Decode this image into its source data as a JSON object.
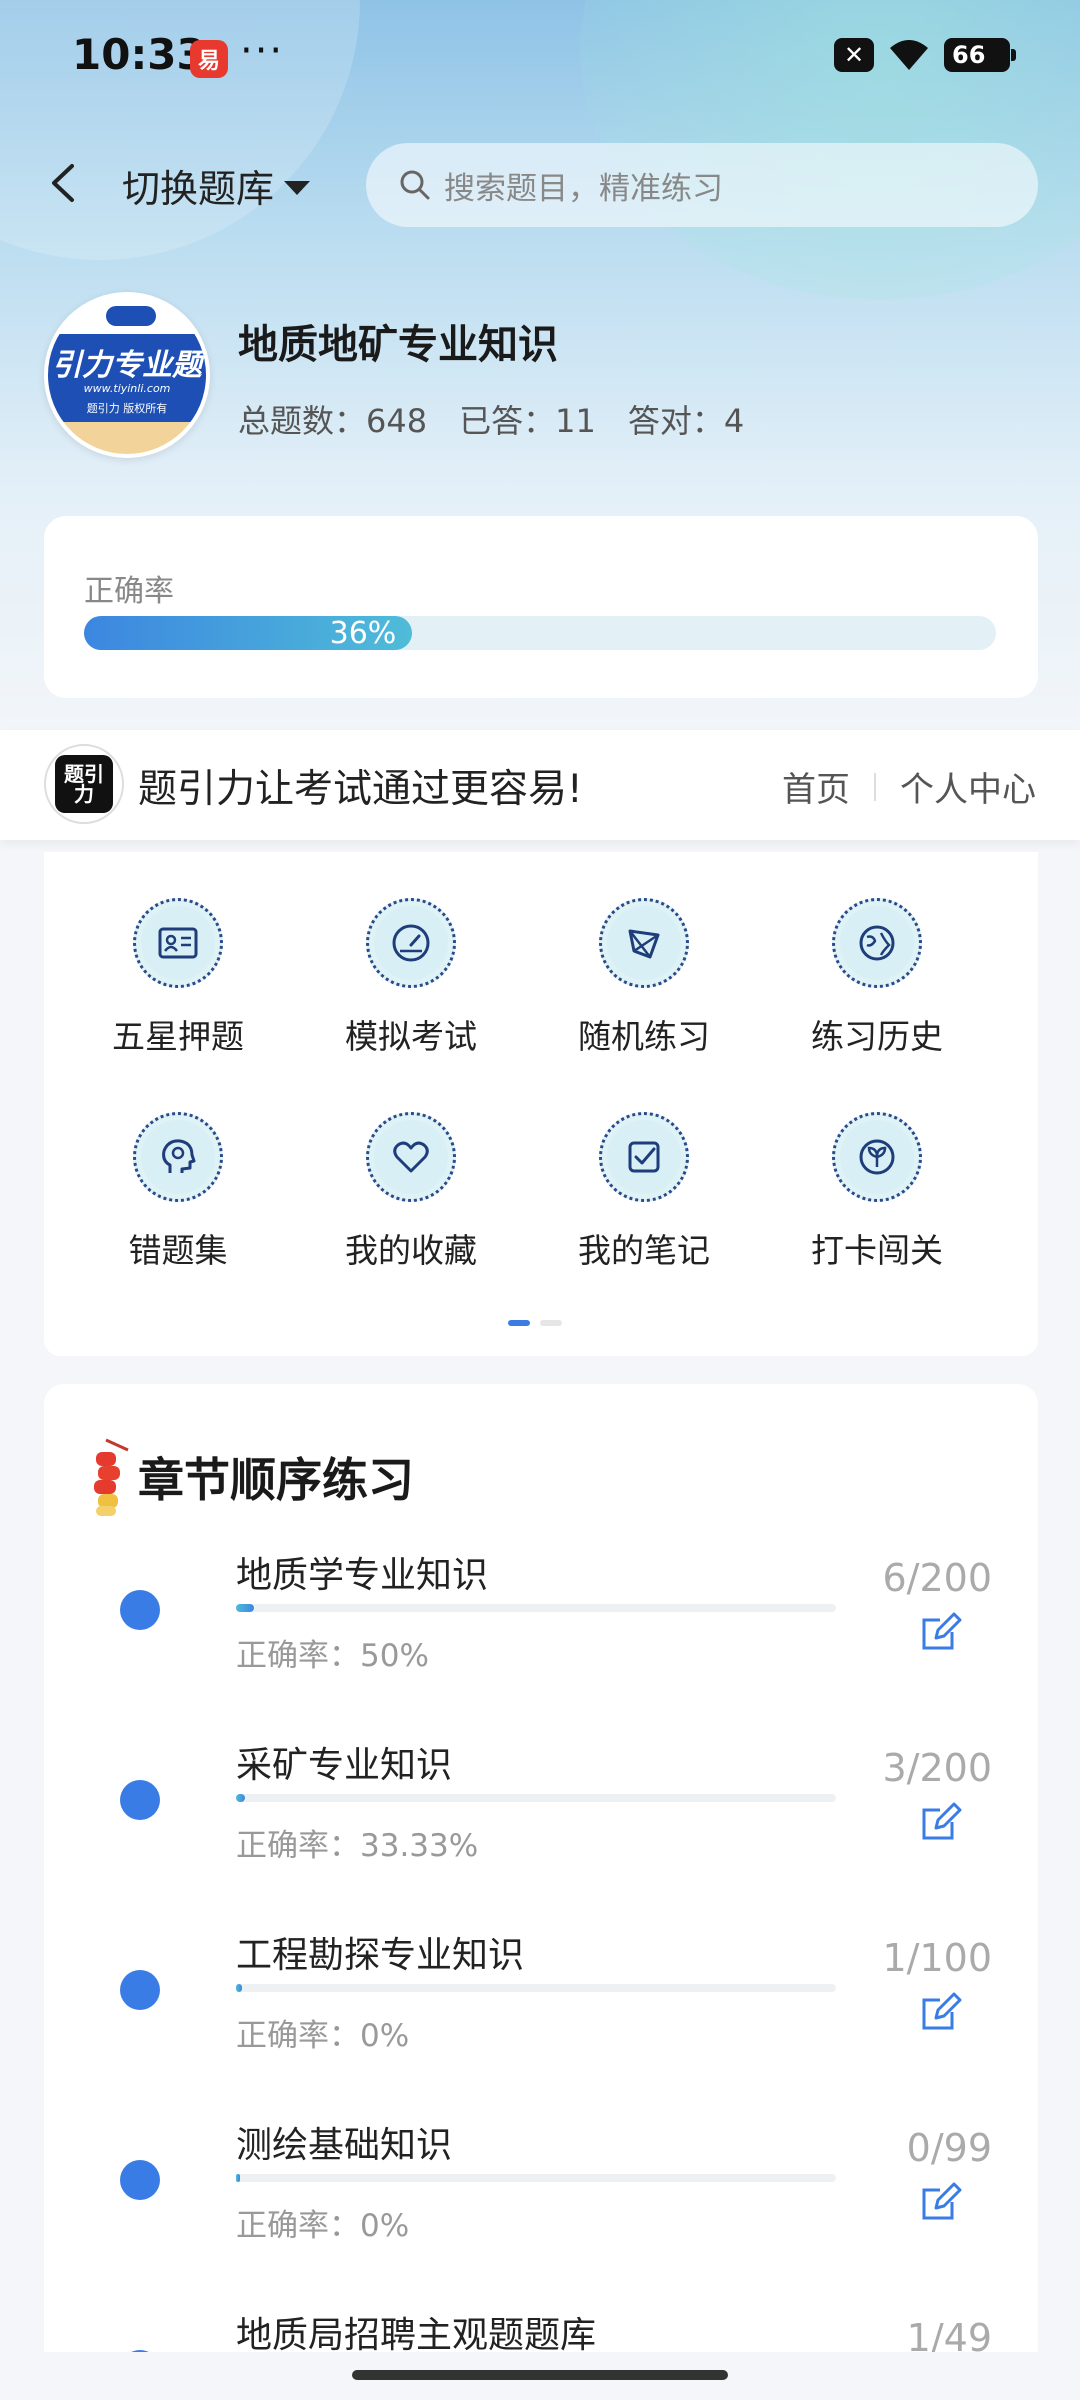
{
  "status_bar": {
    "time": "10:33",
    "app_badge": "易",
    "more": "···",
    "battery": "66"
  },
  "header": {
    "switch_label": "切换题库",
    "search_placeholder": "搜索题目，精准练习"
  },
  "bank": {
    "logo_text": "引力专业题",
    "logo_url": "www.tiyinli.com",
    "logo_sub": "题引力 版权所有",
    "title": "地质地矿专业知识",
    "total": "总题数：648",
    "answered": "已答：11",
    "correct": "答对：4"
  },
  "accuracy": {
    "label": "正确率",
    "value_text": "36%",
    "value": 0.36
  },
  "banner": {
    "logo_text": "题引力",
    "slogan": "题引力让考试通过更容易!",
    "home": "首页",
    "profile": "个人中心"
  },
  "features": [
    {
      "label": "五星押题",
      "icon": "id-card-icon"
    },
    {
      "label": "模拟考试",
      "icon": "gauge-icon"
    },
    {
      "label": "随机练习",
      "icon": "shuffle-icon"
    },
    {
      "label": "练习历史",
      "icon": "globe-icon"
    },
    {
      "label": "错题集",
      "icon": "head-icon"
    },
    {
      "label": "我的收藏",
      "icon": "heart-icon"
    },
    {
      "label": "我的笔记",
      "icon": "note-icon"
    },
    {
      "label": "打卡闯关",
      "icon": "sprout-icon"
    }
  ],
  "chapters": {
    "title": "章节顺序练习",
    "items": [
      {
        "name": "地质学专业知识",
        "accuracy": "正确率：50%",
        "count": "6/200",
        "progress": 0.03
      },
      {
        "name": "采矿专业知识",
        "accuracy": "正确率：33.33%",
        "count": "3/200",
        "progress": 0.015
      },
      {
        "name": "工程勘探专业知识",
        "accuracy": "正确率：0%",
        "count": "1/100",
        "progress": 0.01
      },
      {
        "name": "测绘基础知识",
        "accuracy": "正确率：0%",
        "count": "0/99",
        "progress": 0.0
      },
      {
        "name": "地质局招聘主观题题库",
        "accuracy": "",
        "count": "1/49",
        "progress": 0.02
      }
    ]
  }
}
